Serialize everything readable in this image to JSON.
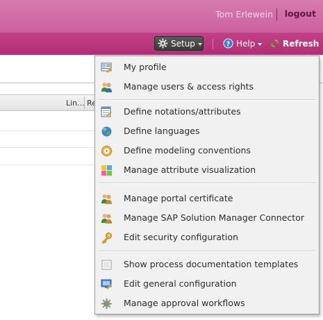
{
  "header": {
    "user_name": "Tom Erlewein",
    "logout_label": "logout"
  },
  "toolbar": {
    "setup_label": "Setup",
    "help_label": "Help",
    "refresh_label": "Refresh"
  },
  "table": {
    "col_lin": "Lin...",
    "col_revis": "Revis"
  },
  "menu": {
    "items": [
      {
        "label": "My profile",
        "icon": "profile-icon"
      },
      {
        "label": "Manage users & access rights",
        "icon": "users-icon"
      },
      {
        "label": "Define notations/attributes",
        "icon": "notations-icon"
      },
      {
        "label": "Define languages",
        "icon": "globe-icon"
      },
      {
        "label": "Define modeling conventions",
        "icon": "conventions-icon"
      },
      {
        "label": "Manage attribute visualization",
        "icon": "visualization-icon"
      },
      {
        "label": "Manage portal certificate",
        "icon": "certificate-icon"
      },
      {
        "label": "Manage SAP Solution Manager Connector",
        "icon": "connector-icon"
      },
      {
        "label": "Edit security configuration",
        "icon": "key-icon"
      },
      {
        "label": "Show process documentation templates",
        "icon": "checkbox-icon"
      },
      {
        "label": "Edit general configuration",
        "icon": "config-icon"
      },
      {
        "label": "Manage approval workflows",
        "icon": "workflow-gear-icon"
      }
    ]
  },
  "colors": {
    "header_pink": "#d77bb0",
    "toolbar_magenta": "#b8347c",
    "menu_bg": "#f1f1f1"
  }
}
